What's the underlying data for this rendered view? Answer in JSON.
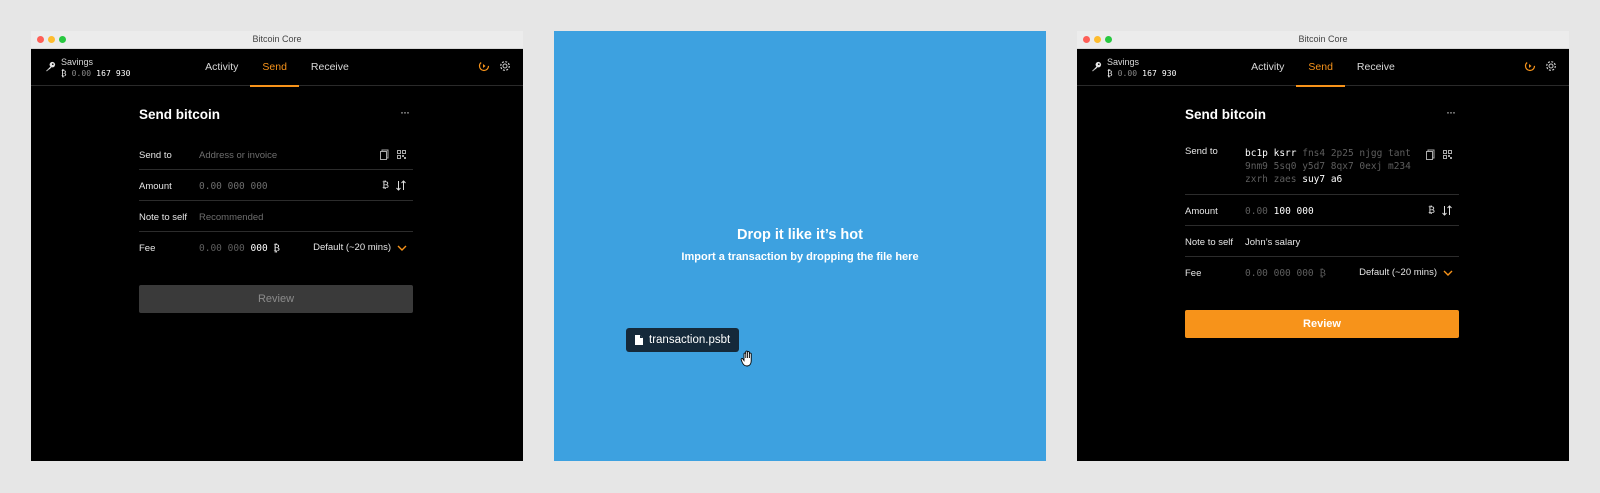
{
  "app_title": "Bitcoin Core",
  "wallet": {
    "name": "Savings",
    "balance_symbol": "₿",
    "balance_dim": "0.00",
    "balance_bright": "167 930"
  },
  "nav": {
    "tabs": [
      "Activity",
      "Send",
      "Receive"
    ],
    "active": "Send"
  },
  "icons": {
    "wallet": "key-icon",
    "sync": "sync-status-icon",
    "settings": "gear-icon",
    "paste": "paste-icon",
    "qr": "qr-code-icon",
    "unit_toggle": "swap-arrows-icon",
    "fee_dropdown": "chevron-down-icon",
    "file": "file-icon",
    "cursor": "grab-hand-cursor-icon"
  },
  "colors": {
    "accent": "#f7931a",
    "drop_bg": "#3da1e0",
    "window_bg": "#000000"
  },
  "send_empty": {
    "title": "Send bitcoin",
    "more": "···",
    "send_to_label": "Send to",
    "send_to_placeholder": "Address or invoice",
    "amount_label": "Amount",
    "amount_placeholder": "0.00 000 000",
    "amount_unit": "₿",
    "note_label": "Note to self",
    "note_placeholder": "Recommended",
    "fee_label": "Fee",
    "fee_dim": "0.00 000",
    "fee_bright": "000 ₿",
    "fee_option": "Default (~20 mins)",
    "review_label": "Review"
  },
  "drop_zone": {
    "title": "Drop it like it’s hot",
    "subtitle": "Import a transaction by dropping the file here",
    "file_name": "transaction.psbt"
  },
  "send_filled": {
    "title": "Send bitcoin",
    "more": "···",
    "send_to_label": "Send to",
    "address_line1_bright": "bc1p ksrr",
    "address_line1_dim": "fns4 2p25 njgg tant",
    "address_line2_dim": "9nm9 5sq0 y5d7 8qx7 0exj m234",
    "address_line3_dim": "zxrh zaes",
    "address_line3_bright": "suy7 a6",
    "amount_label": "Amount",
    "amount_dim": "0.00",
    "amount_bright": "100 000",
    "amount_unit": "₿",
    "note_label": "Note to self",
    "note_value": "John’s salary",
    "fee_label": "Fee",
    "fee_value": "0.00 000 000 ₿",
    "fee_option": "Default (~20 mins)",
    "review_label": "Review"
  }
}
